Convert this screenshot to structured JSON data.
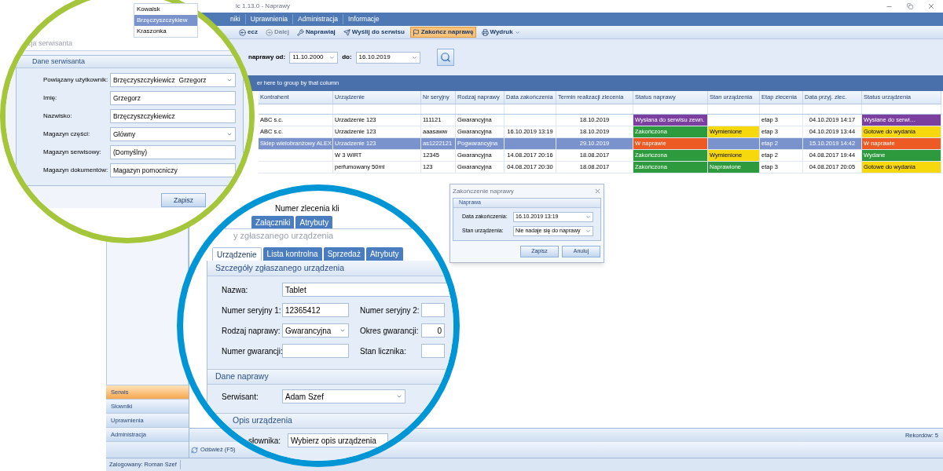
{
  "window": {
    "title": "ic 1.13.0 - Naprawy"
  },
  "user_dropdown": [
    {
      "label": "Kowalsk",
      "selected": false
    },
    {
      "label": "Brzęczyszczykiew",
      "selected": true
    },
    {
      "label": "Kraszonka",
      "selected": false
    }
  ],
  "menu": [
    "niki",
    "Uprawnienia",
    "Administracja",
    "Informacje"
  ],
  "toolbar": [
    {
      "kind": "back",
      "label": "ecz",
      "disabled": false,
      "highlighted": false
    },
    {
      "kind": "next",
      "label": "Dalej",
      "disabled": true,
      "highlighted": false
    },
    {
      "kind": "repair",
      "label": "Naprawiaj",
      "disabled": false,
      "highlighted": false
    },
    {
      "kind": "send",
      "label": "Wyślij do serwisu",
      "disabled": false,
      "highlighted": false
    },
    {
      "kind": "finish",
      "label": "Zakończ naprawę",
      "disabled": false,
      "highlighted": true
    },
    {
      "kind": "print",
      "label": "Wydruk",
      "disabled": false,
      "highlighted": false
    }
  ],
  "filter": {
    "from_label": "naprawy od:",
    "from": "11.10.2000",
    "to_label": "do:",
    "to": "16.10.2019"
  },
  "group_panel": "er here to group by that column",
  "grid": {
    "columns": [
      "Kontrahent",
      "Urządzenie",
      "Nr seryjny",
      "Rodzaj naprawy",
      "Data zakończenia",
      "Termin realizacji zlecenia",
      "Status naprawy",
      "Stan urządzenia",
      "Etap zlecenia",
      "Data przyj. zlec.",
      "Status urządzenia"
    ],
    "rows": [
      {
        "selected": false,
        "cells": [
          {
            "text": "ABC s.c."
          },
          {
            "text": "Urzadzenie 123"
          },
          {
            "text": "111121"
          },
          {
            "text": "Gwarancyjna"
          },
          {},
          {
            "text": "18.10.2019"
          },
          {
            "text": "Wysłana do serwisu zewn.",
            "color": "#7b3fa0"
          },
          {},
          {
            "text": "etap 3"
          },
          {
            "text": "04.10.2019 14:17"
          },
          {
            "text": "Wysłane do serwi…",
            "color": "#7b3fa0"
          }
        ]
      },
      {
        "selected": false,
        "cells": [
          {
            "text": "ABC s.c."
          },
          {
            "text": "Urzadzenie 123"
          },
          {
            "text": "aaasaww"
          },
          {
            "text": "Gwarancyjna"
          },
          {
            "text": "16.10.2019 13:19"
          },
          {
            "text": "18.10.2019"
          },
          {
            "text": "Zakończona",
            "color": "#2e9a3e"
          },
          {
            "text": "Wymienione",
            "color": "#f6d80c"
          },
          {
            "text": "etap 3"
          },
          {
            "text": "04.10.2019 13:44"
          },
          {
            "text": "Gotowe do wydania",
            "color": "#f6d80c"
          }
        ]
      },
      {
        "selected": true,
        "cells": [
          {
            "text": "Sklep wielobranżowy ALEX"
          },
          {
            "text": "Urzadzenie 123"
          },
          {
            "text": "as1222121"
          },
          {
            "text": "Pogwarancyjna"
          },
          {},
          {
            "text": "29.10.2019"
          },
          {
            "text": "W naprawie",
            "color": "#ee5a24"
          },
          {},
          {
            "text": "etap 2"
          },
          {
            "text": "15.10.2019 14:42"
          },
          {
            "text": "W naprawie",
            "color": "#ee5a24"
          }
        ]
      },
      {
        "selected": false,
        "cells": [
          {},
          {
            "text": "W 3 WIRT"
          },
          {
            "text": "12345"
          },
          {
            "text": "Gwarancyjna"
          },
          {
            "text": "14.08.2017 20:16"
          },
          {
            "text": "18.08.2017"
          },
          {
            "text": "Zakończona",
            "color": "#2e9a3e"
          },
          {
            "text": "Wymienione",
            "color": "#f6d80c"
          },
          {
            "text": "etap 2"
          },
          {
            "text": "04.08.2017 19:44"
          },
          {
            "text": "Wydane",
            "color": "#2e9a3e"
          }
        ]
      },
      {
        "selected": false,
        "cells": [
          {},
          {
            "text": "perfumowany 50ml"
          },
          {
            "text": "123"
          },
          {
            "text": "Gwarancyjna"
          },
          {
            "text": "04.08.2017 20:30"
          },
          {
            "text": "18.08.2017"
          },
          {
            "text": "Zakończona",
            "color": "#2e9a3e"
          },
          {
            "text": "Naprawione",
            "color": "#2e9a3e"
          },
          {
            "text": "etap 3"
          },
          {
            "text": "04.08.2017 20:05"
          },
          {
            "text": "Gotowe do wydania",
            "color": "#f6d80c"
          }
        ]
      }
    ],
    "records": "Rekordów: 5"
  },
  "sidebar": [
    {
      "label": "Serwis",
      "selected": true
    },
    {
      "label": "Słowniki",
      "selected": false
    },
    {
      "label": "Uprawnienia",
      "selected": false
    },
    {
      "label": "Administracja",
      "selected": false
    }
  ],
  "refresh": "Odśwież (F5)",
  "status_bar": "Zalogowany: Roman Szef",
  "servicer_dialog": {
    "title": "cja serwisanta",
    "group": "Dane serwisanta",
    "fields": [
      {
        "label": "Powiązany użytkownik:",
        "value": "Brzęczyszczykiewicz  Grzegorz",
        "kind": "dropdown"
      },
      {
        "label": "Imię:",
        "value": "Grzegorz",
        "kind": "text"
      },
      {
        "label": "Nazwisko:",
        "value": "Brzęczyszczykiewicz",
        "kind": "text"
      },
      {
        "label": "Magazyn części:",
        "value": "Główny",
        "kind": "dropdown"
      },
      {
        "label": "Magazyn serwisowy:",
        "value": "(Domyślny)",
        "kind": "text"
      },
      {
        "label": "Magazyn dokumentów:",
        "value": "Magazyn pomocniczy",
        "kind": "text"
      }
    ],
    "buttons": [
      "Zapisz"
    ]
  },
  "device_dialog": {
    "order_label": "Numer zlecenia kli",
    "outer_tabs": [
      {
        "label": "Załączniki",
        "selected": false
      },
      {
        "label": "Atrybuty",
        "selected": false
      }
    ],
    "title": "y zgłaszanego urządzenia",
    "tabs": [
      {
        "label": "Urządzenie",
        "selected": true
      },
      {
        "label": "Lista kontrolna",
        "selected": false
      },
      {
        "label": "Sprzedaż",
        "selected": false
      },
      {
        "label": "Atrybuty",
        "selected": false
      }
    ],
    "details": {
      "title": "Szczegóły zgłaszanego urządzenia",
      "name": {
        "label": "Nazwa:",
        "value": "Tablet"
      },
      "rows": [
        [
          {
            "label": "Numer seryjny 1:",
            "value": "12365412",
            "kind": "text"
          },
          {
            "label": "Numer seryjny 2:",
            "kind": "text"
          }
        ],
        [
          {
            "label": "Rodzaj naprawy:",
            "value": "Gwarancyjna",
            "kind": "dropdown"
          },
          {
            "label": "Okres gwarancji:",
            "value": "0",
            "kind": "number"
          }
        ],
        [
          {
            "label": "Numer gwarancji:",
            "kind": "text"
          },
          {
            "label": "Stan licznika:",
            "kind": "text"
          }
        ]
      ]
    },
    "repair": {
      "title": "Dane naprawy",
      "label": "Serwisant:",
      "value": "Adam Szef"
    },
    "description": {
      "title": "Opis urządzenia",
      "label": "słownika:",
      "value": "Wybierz opis urządzenia"
    }
  },
  "finish_dialog": {
    "title": "Zakończenie naprawy",
    "group": "Naprawa",
    "fields": [
      {
        "label": "Data zakończenia:",
        "value": "16.10.2019 13:19"
      },
      {
        "label": "Stan urządzenia:",
        "value": "Nie nadaje się do naprawy"
      }
    ],
    "buttons": [
      "Zapisz",
      "Anuluj"
    ]
  }
}
